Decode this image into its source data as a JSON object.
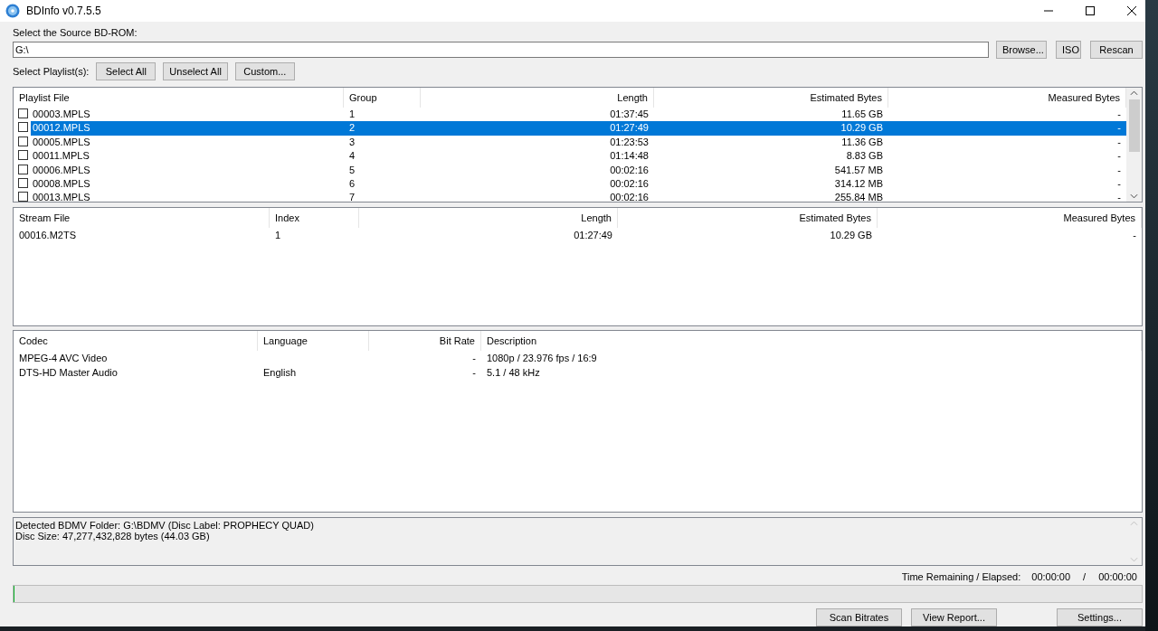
{
  "window": {
    "title": "BDInfo v0.7.5.5"
  },
  "source": {
    "label": "Select the Source BD-ROM:",
    "value": "G:\\",
    "buttons": [
      "Browse...",
      "ISO",
      "Rescan"
    ]
  },
  "playlist_select": {
    "label": "Select Playlist(s):",
    "buttons": [
      "Select All",
      "Unselect All",
      "Custom..."
    ]
  },
  "playlists": {
    "columns": [
      "Playlist File",
      "Group",
      "Length",
      "Estimated Bytes",
      "Measured Bytes"
    ],
    "rows": [
      {
        "cells": [
          "00003.MPLS",
          "1",
          "01:37:45",
          "11.65 GB",
          "-"
        ],
        "checked": false,
        "selected": false
      },
      {
        "cells": [
          "00012.MPLS",
          "2",
          "01:27:49",
          "10.29 GB",
          "-"
        ],
        "checked": false,
        "selected": true
      },
      {
        "cells": [
          "00005.MPLS",
          "3",
          "01:23:53",
          "11.36 GB",
          "-"
        ],
        "checked": false,
        "selected": false
      },
      {
        "cells": [
          "00011.MPLS",
          "4",
          "01:14:48",
          "8.83 GB",
          "-"
        ],
        "checked": false,
        "selected": false
      },
      {
        "cells": [
          "00006.MPLS",
          "5",
          "00:02:16",
          "541.57 MB",
          "-"
        ],
        "checked": false,
        "selected": false
      },
      {
        "cells": [
          "00008.MPLS",
          "6",
          "00:02:16",
          "314.12 MB",
          "-"
        ],
        "checked": false,
        "selected": false
      },
      {
        "cells": [
          "00013.MPLS",
          "7",
          "00:02:16",
          "255.84 MB",
          "-"
        ],
        "checked": false,
        "selected": false
      }
    ]
  },
  "streams": {
    "columns": [
      "Stream File",
      "Index",
      "Length",
      "Estimated Bytes",
      "Measured Bytes"
    ],
    "rows": [
      [
        "00016.M2TS",
        "1",
        "01:27:49",
        "10.29 GB",
        "-"
      ]
    ]
  },
  "codecs": {
    "columns": [
      "Codec",
      "Language",
      "Bit Rate",
      "Description"
    ],
    "rows": [
      [
        "MPEG-4 AVC Video",
        "",
        "-",
        "1080p / 23.976 fps / 16:9"
      ],
      [
        "DTS-HD Master Audio",
        "English",
        "-",
        "5.1 / 48 kHz"
      ]
    ]
  },
  "log": [
    "Detected BDMV Folder: G:\\BDMV (Disc Label: PROPHECY QUAD)",
    "Disc Size: 47,277,432,828 bytes (44.03 GB)"
  ],
  "time": {
    "label": "Time Remaining / Elapsed:",
    "remaining": "00:00:00",
    "separator": "/",
    "elapsed": "00:00:00"
  },
  "progress": {
    "level": 0
  },
  "buttons": [
    "Scan Bitrates",
    "View Report...",
    "Settings..."
  ]
}
